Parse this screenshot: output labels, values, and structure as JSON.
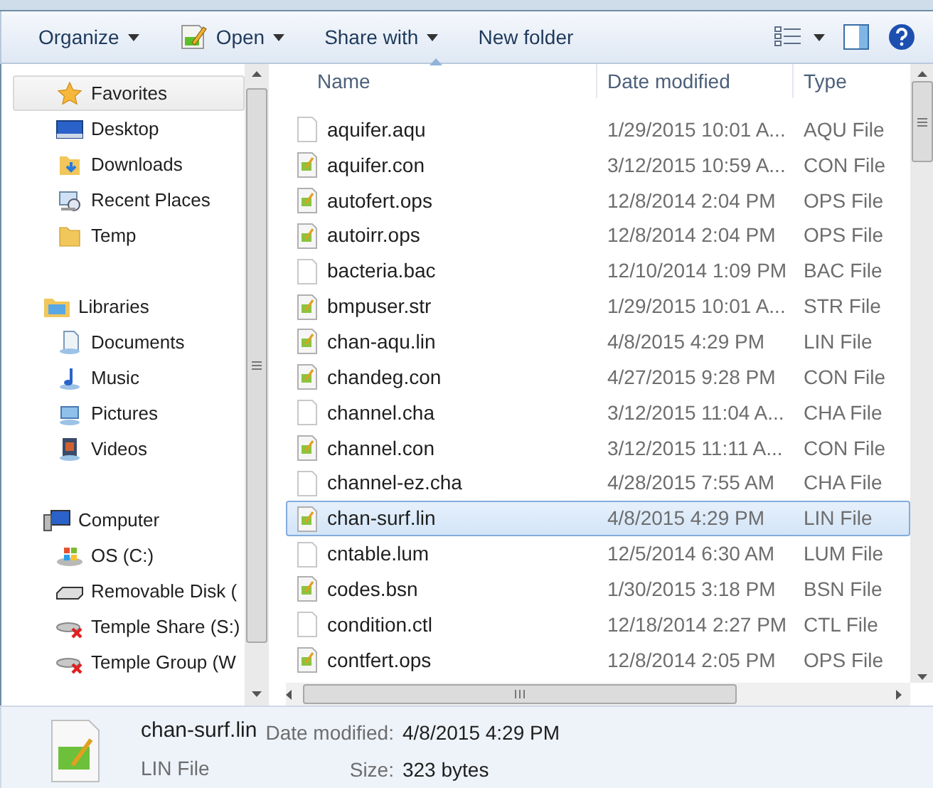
{
  "toolbar": {
    "buttons": [
      {
        "label": "Organize",
        "kind": "menu"
      },
      {
        "label": "Open",
        "kind": "split"
      },
      {
        "label": "Share with",
        "kind": "menu"
      },
      {
        "label": "New folder",
        "kind": "plain"
      }
    ]
  },
  "sidebar": {
    "groups": [
      {
        "label": "Favorites",
        "selected": true,
        "children": [
          {
            "label": "Desktop"
          },
          {
            "label": "Downloads"
          },
          {
            "label": "Recent Places"
          },
          {
            "label": "Temp"
          }
        ]
      },
      {
        "label": "Libraries",
        "selected": false,
        "children": [
          {
            "label": "Documents"
          },
          {
            "label": "Music"
          },
          {
            "label": "Pictures"
          },
          {
            "label": "Videos"
          }
        ]
      },
      {
        "label": "Computer",
        "selected": false,
        "children": [
          {
            "label": "OS (C:)"
          },
          {
            "label": "Removable Disk ("
          },
          {
            "label": "Temple Share (S:)"
          },
          {
            "label": "Temple Group (W"
          }
        ]
      }
    ]
  },
  "file_list": {
    "columns": [
      "Name",
      "Date modified",
      "Type"
    ],
    "rows": [
      {
        "name": "aquifer.aqu",
        "date": "1/29/2015 10:01 A...",
        "type": "AQU File",
        "kind": "plain",
        "selected": false
      },
      {
        "name": "aquifer.con",
        "date": "3/12/2015 10:59 A...",
        "type": "CON File",
        "kind": "script",
        "selected": false
      },
      {
        "name": "autofert.ops",
        "date": "12/8/2014 2:04 PM",
        "type": "OPS File",
        "kind": "script",
        "selected": false
      },
      {
        "name": "autoirr.ops",
        "date": "12/8/2014 2:04 PM",
        "type": "OPS File",
        "kind": "script",
        "selected": false
      },
      {
        "name": "bacteria.bac",
        "date": "12/10/2014 1:09 PM",
        "type": "BAC File",
        "kind": "plain",
        "selected": false
      },
      {
        "name": "bmpuser.str",
        "date": "1/29/2015 10:01 A...",
        "type": "STR File",
        "kind": "script",
        "selected": false
      },
      {
        "name": "chan-aqu.lin",
        "date": "4/8/2015 4:29 PM",
        "type": "LIN File",
        "kind": "script",
        "selected": false
      },
      {
        "name": "chandeg.con",
        "date": "4/27/2015 9:28 PM",
        "type": "CON File",
        "kind": "script",
        "selected": false
      },
      {
        "name": "channel.cha",
        "date": "3/12/2015 11:04 A...",
        "type": "CHA File",
        "kind": "plain",
        "selected": false
      },
      {
        "name": "channel.con",
        "date": "3/12/2015 11:11 A...",
        "type": "CON File",
        "kind": "script",
        "selected": false
      },
      {
        "name": "channel-ez.cha",
        "date": "4/28/2015 7:55 AM",
        "type": "CHA File",
        "kind": "plain",
        "selected": false
      },
      {
        "name": "chan-surf.lin",
        "date": "4/8/2015 4:29 PM",
        "type": "LIN File",
        "kind": "script",
        "selected": true
      },
      {
        "name": "cntable.lum",
        "date": "12/5/2014 6:30 AM",
        "type": "LUM File",
        "kind": "plain",
        "selected": false
      },
      {
        "name": "codes.bsn",
        "date": "1/30/2015 3:18 PM",
        "type": "BSN File",
        "kind": "script",
        "selected": false
      },
      {
        "name": "condition.ctl",
        "date": "12/18/2014 2:27 PM",
        "type": "CTL File",
        "kind": "plain",
        "selected": false
      },
      {
        "name": "contfert.ops",
        "date": "12/8/2014 2:05 PM",
        "type": "OPS File",
        "kind": "script",
        "selected": false
      }
    ]
  },
  "details": {
    "name": "chan-surf.lin",
    "type": "LIN File",
    "date_label": "Date modified:",
    "date": "4/8/2015 4:29 PM",
    "size_label": "Size:",
    "size": "323 bytes"
  }
}
